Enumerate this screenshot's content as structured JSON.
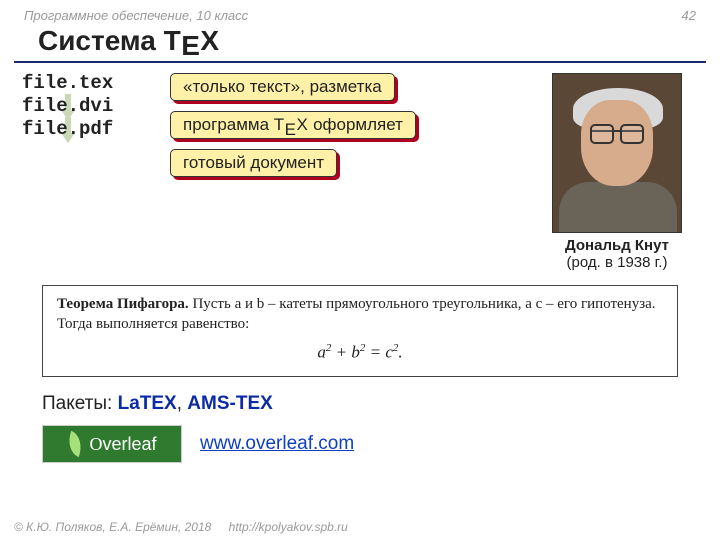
{
  "header": {
    "subject": "Программное обеспечение, 10 класс",
    "page": "42"
  },
  "title": {
    "prefix": "Система ",
    "tex_T": "T",
    "tex_E": "E",
    "tex_X": "X"
  },
  "flow": {
    "src": "file.tex",
    "dvi": "file.dvi",
    "pdf": "file.pdf"
  },
  "callouts": {
    "c1": "«только текст», разметка",
    "c2_pre": "программа ",
    "c2_T": "T",
    "c2_E": "E",
    "c2_X": "X",
    "c2_post": " оформляет",
    "c3": "готовый документ"
  },
  "portrait": {
    "name": "Дональд Кнут",
    "sub": "(род. в 1938 г.)"
  },
  "theorem": {
    "lead": "Теорема Пифагора.",
    "body": " Пусть a и b – катеты прямоугольного треугольника, а c – его гипотенуза. Тогда выполняется равенство:",
    "formula_a": "a",
    "formula_b": "b",
    "formula_c": "c",
    "sq": "2",
    "eq": " = ",
    "plus": " + ",
    "dot": "."
  },
  "packages": {
    "label": "Пакеты: ",
    "p1": "LaTEX",
    "sep": ", ",
    "p2": "AMS-TEX"
  },
  "overleaf": {
    "logo_text": "verleaf",
    "url": "www.overleaf.com"
  },
  "footer": {
    "copy": "© К.Ю. Поляков, Е.А. Ерёмин, 2018",
    "url": "http://kpolyakov.spb.ru"
  }
}
